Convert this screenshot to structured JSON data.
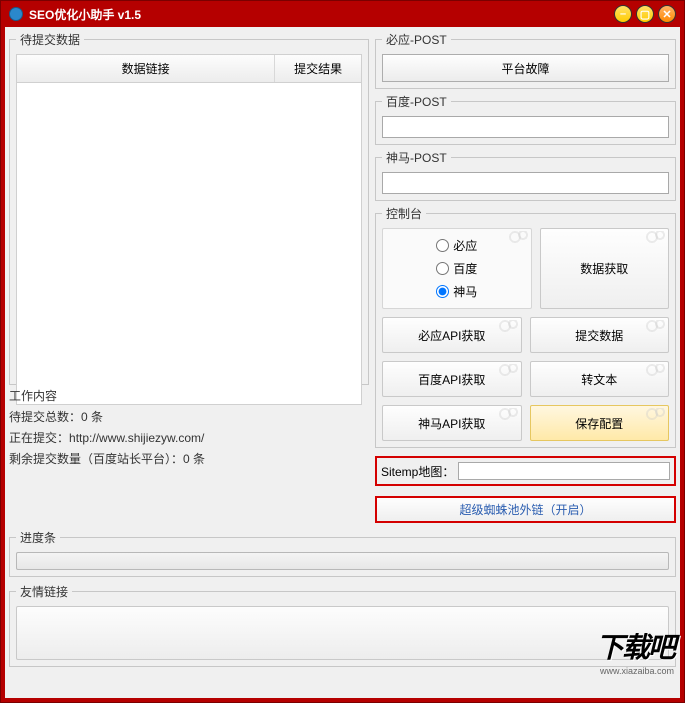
{
  "window": {
    "title": "SEO优化小助手 v1.5"
  },
  "pending": {
    "legend": "待提交数据",
    "col_link": "数据链接",
    "col_result": "提交结果"
  },
  "work": {
    "legend": "工作内容",
    "line1_label": "待提交总数：",
    "line1_value": "0 条",
    "line2_label": "正在提交：",
    "line2_value": "http://www.shijiezyw.com/",
    "line3_label": "剩余提交数量（百度站长平台）：",
    "line3_value": "0 条"
  },
  "post_bing": {
    "legend": "必应-POST",
    "button": "平台故障",
    "value": ""
  },
  "post_baidu": {
    "legend": "百度-POST",
    "value": ""
  },
  "post_shenma": {
    "legend": "神马-POST",
    "value": ""
  },
  "console": {
    "legend": "控制台",
    "radio_bing": "必应",
    "radio_baidu": "百度",
    "radio_shenma": "神马",
    "btn_fetch": "数据获取",
    "btn_bing_api": "必应API获取",
    "btn_submit": "提交数据",
    "btn_baidu_api": "百度API获取",
    "btn_totext": "转文本",
    "btn_shenma_api": "神马API获取",
    "btn_saveconf": "保存配置"
  },
  "sitemap": {
    "label": "Sitemp地图：",
    "value": ""
  },
  "spider": {
    "button": "超级蜘蛛池外链（开启）"
  },
  "progress": {
    "legend": "进度条"
  },
  "friends": {
    "legend": "友情链接"
  },
  "watermark": {
    "text": "下载吧",
    "url": "www.xiazaiba.com"
  }
}
